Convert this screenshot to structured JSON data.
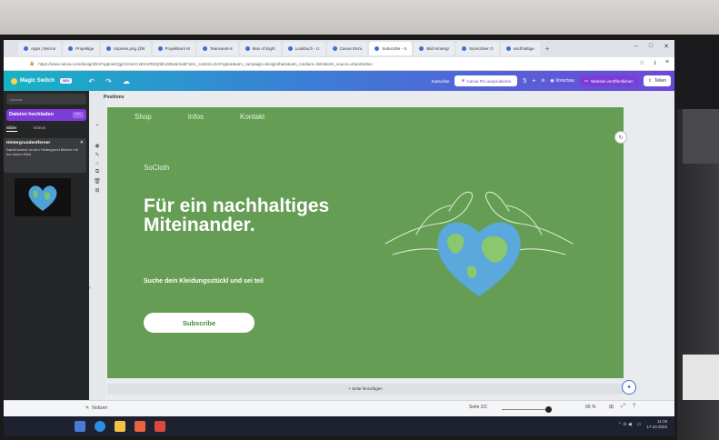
{
  "browser": {
    "tabs": [
      {
        "label": "Apps | Micros"
      },
      {
        "label": "Projektige"
      },
      {
        "label": "Impress.png @ht"
      },
      {
        "label": "Projektkurs M"
      },
      {
        "label": "Teamwork-8"
      },
      {
        "label": "Max of Eight"
      },
      {
        "label": "Lookbuch - Iz"
      },
      {
        "label": "Canva Dezu"
      },
      {
        "label": "Subscribe - X",
        "active": true
      },
      {
        "label": "Bild Hintergr"
      },
      {
        "label": "Sicenzilver O"
      },
      {
        "label": "nachhaltige"
      }
    ],
    "address": "https://www.canva.com/design/DAFsg5oeKQg/zzmoVCxEtA2REQ0bhc5Ew6r/edit?utm_content=DAFsg5oe&utm_campaign=designshare&utm_medium=link2&utm_source=sharebutton"
  },
  "topbar": {
    "magic_label": "Magic Switch",
    "new_badge": "NEU",
    "subscribe_link": "Subscribe",
    "pro_button": "Canva Pro ausprobieren",
    "count": "5",
    "preview": "Vorschau",
    "publish": "Website veröffentlichen",
    "share": "Teilen"
  },
  "left_panel": {
    "search_placeholder": "Uploads",
    "upload_button": "Dateien hochladen",
    "upload_more": "···",
    "tab_images": "Bilder",
    "tab_videos": "Videos",
    "card_title": "Hintergrundentferner",
    "card_desc": "Damit kannst du den Hintergrund Bildern mit nur einem Klick"
  },
  "canvas": {
    "positions_label": "Positions",
    "nav": [
      "Shop",
      "Infos",
      "Kontakt"
    ],
    "brand": "SoCloth",
    "headline": "Für ein nachhaltiges Miteinander.",
    "subtext": "Suche dein Kleidungsstückl und sei teil",
    "subscribe_button": "Subscribe",
    "add_page": "+ Seite hinzufügen",
    "bg_color": "#649d53"
  },
  "status": {
    "notes": "Notizen",
    "page_info": "Seite 2/2",
    "zoom": "99 %",
    "zoom_fraction": 0.99
  },
  "taskbar": {
    "time": "11:19",
    "date": "17.10.2023"
  }
}
